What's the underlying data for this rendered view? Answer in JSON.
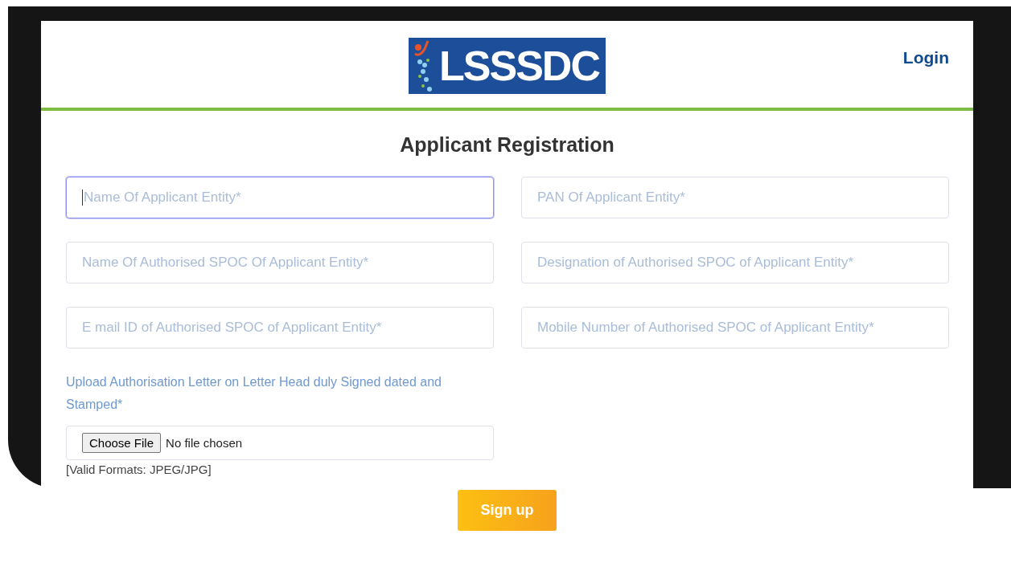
{
  "header": {
    "logo_text": "LSSSDC",
    "login_link": "Login"
  },
  "form": {
    "title": "Applicant Registration",
    "fields": [
      {
        "placeholder": "Name Of Applicant Entity*",
        "focused": true
      },
      {
        "placeholder": "PAN Of Applicant Entity*",
        "focused": false
      },
      {
        "placeholder": "Name Of Authorised SPOC Of Applicant Entity*",
        "focused": false
      },
      {
        "placeholder": "Designation of Authorised SPOC of Applicant Entity*",
        "focused": false
      },
      {
        "placeholder": "E mail ID of Authorised SPOC of Applicant Entity*",
        "focused": false
      },
      {
        "placeholder": "Mobile Number of Authorised SPOC of Applicant Entity*",
        "focused": false
      }
    ],
    "upload": {
      "label": "Upload Authorisation Letter on Letter Head duly Signed dated and Stamped*",
      "button": "Choose File",
      "status": "No file chosen",
      "hint": "[Valid Formats: JPEG/JPG]"
    },
    "submit": "Sign up"
  }
}
